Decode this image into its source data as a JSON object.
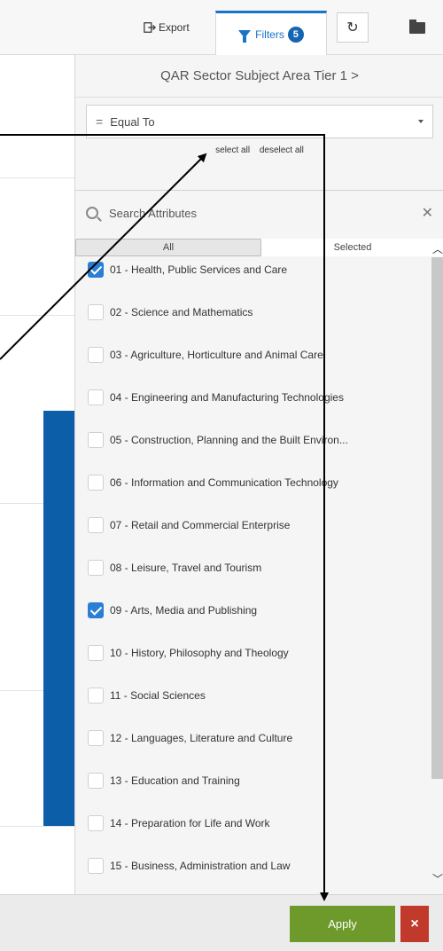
{
  "toolbar": {
    "export_label": "Export",
    "filters_label": "Filters",
    "filters_count": "5",
    "reset_symbol": "↻"
  },
  "panel": {
    "title": "QAR Sector Subject Area Tier 1 >",
    "operator": "Equal To",
    "select_all": "select all",
    "deselect_all": "deselect all",
    "search_placeholder": "Search Attributes",
    "tab_all": "All",
    "tab_selected": "Selected"
  },
  "attributes": [
    {
      "label": "01 - Health, Public Services and Care",
      "checked": true
    },
    {
      "label": "02 - Science and Mathematics",
      "checked": false
    },
    {
      "label": "03 - Agriculture, Horticulture and Animal Care",
      "checked": false
    },
    {
      "label": "04 - Engineering and Manufacturing Technologies",
      "checked": false
    },
    {
      "label": "05 - Construction, Planning and the Built Environ...",
      "checked": false
    },
    {
      "label": "06 - Information and Communication Technology",
      "checked": false
    },
    {
      "label": "07 - Retail and Commercial Enterprise",
      "checked": false
    },
    {
      "label": "08 - Leisure, Travel and Tourism",
      "checked": false
    },
    {
      "label": "09 - Arts, Media and Publishing",
      "checked": true
    },
    {
      "label": "10 - History, Philosophy and Theology",
      "checked": false
    },
    {
      "label": "11 - Social Sciences",
      "checked": false
    },
    {
      "label": "12 - Languages, Literature and Culture",
      "checked": false
    },
    {
      "label": "13 - Education and Training",
      "checked": false
    },
    {
      "label": "14 - Preparation for Life and Work",
      "checked": false
    },
    {
      "label": "15 - Business, Administration and Law",
      "checked": false
    }
  ],
  "footer": {
    "apply_label": "Apply",
    "cancel_symbol": "×"
  },
  "colors": {
    "accent": "#1a73c7",
    "apply": "#6d9a2b",
    "cancel": "#c0392b",
    "checkbox_checked": "#2a7fd4"
  }
}
